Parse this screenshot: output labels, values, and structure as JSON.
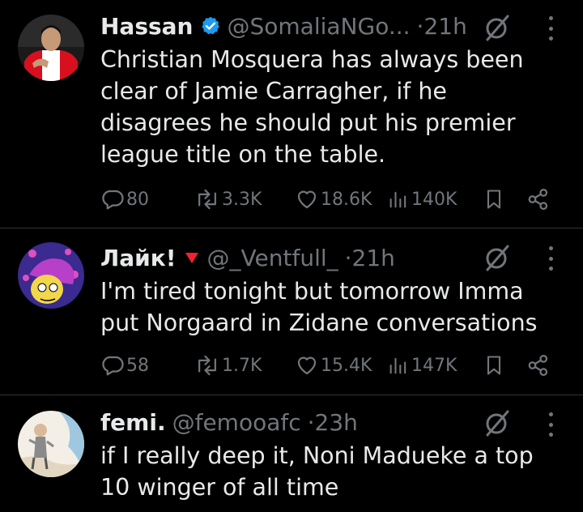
{
  "tweets": [
    {
      "name": "Hassan",
      "verified": true,
      "handle": "@SomaliaNGo...",
      "separator": "·",
      "time": "21h",
      "text": "Christian Mosquera has always been clear of Jamie Carragher, if he disagrees he should put his premier league title on the table.",
      "replies": "80",
      "reposts": "3.3K",
      "likes": "18.6K",
      "views": "140K"
    },
    {
      "name": "Лайк!",
      "flag_icon": "red-triangle-icon",
      "handle": "@_Ventfull_",
      "separator": "·",
      "time": "21h",
      "text": "I'm tired tonight but tomorrow Imma put Norgaard in Zidane conversations",
      "replies": "58",
      "reposts": "1.7K",
      "likes": "15.4K",
      "views": "147K"
    },
    {
      "name": "femi.",
      "handle": "@femooafc",
      "separator": "·",
      "time": "23h",
      "text": "if I really deep it, Noni Madueke a top 10 winger of all time"
    }
  ],
  "colors": {
    "background": "#000000",
    "text": "#e7e9ea",
    "muted": "#71767b",
    "verified": "#1d9bf0",
    "divider": "#2f3336",
    "flag": "#f4212e"
  }
}
